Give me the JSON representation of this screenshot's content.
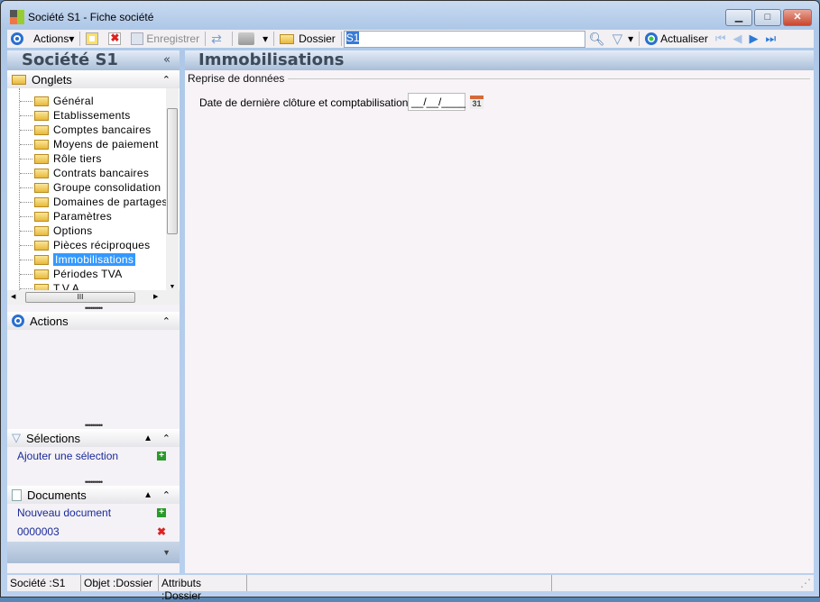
{
  "window": {
    "title": "Société S1 -  Fiche société"
  },
  "toolbar": {
    "actions": "Actions",
    "save": "Enregistrer",
    "dossier": "Dossier",
    "search_value": "S1",
    "refresh": "Actualiser"
  },
  "left": {
    "title": "Société S1",
    "onglets": {
      "label": "Onglets",
      "items": [
        "Général",
        "Etablissements",
        "Comptes bancaires",
        "Moyens de paiement",
        "Rôle tiers",
        "Contrats bancaires",
        "Groupe consolidation",
        "Domaines de partages",
        "Paramètres",
        "Options",
        "Pièces réciproques",
        "Immobilisations",
        "Périodes TVA",
        "T.V.A."
      ],
      "selected": "Immobilisations"
    },
    "actions": {
      "label": "Actions"
    },
    "selections": {
      "label": "Sélections",
      "items": [
        "Ajouter une sélection"
      ]
    },
    "documents": {
      "label": "Documents",
      "items": [
        "Nouveau document",
        "0000003"
      ]
    }
  },
  "main": {
    "title": "Immobilisations",
    "group": "Reprise de données",
    "field_label": "Date de dernière clôture et comptabilisation :",
    "field_value": "__/__/____",
    "calendar_day": "31"
  },
  "status": {
    "societe": "Société :S1",
    "objet": "Objet :Dossier",
    "attributs": "Attributs :Dossier"
  },
  "colors": {
    "accent": "#3399ff",
    "link": "#1a2a9a",
    "header": "#a9bed8"
  }
}
